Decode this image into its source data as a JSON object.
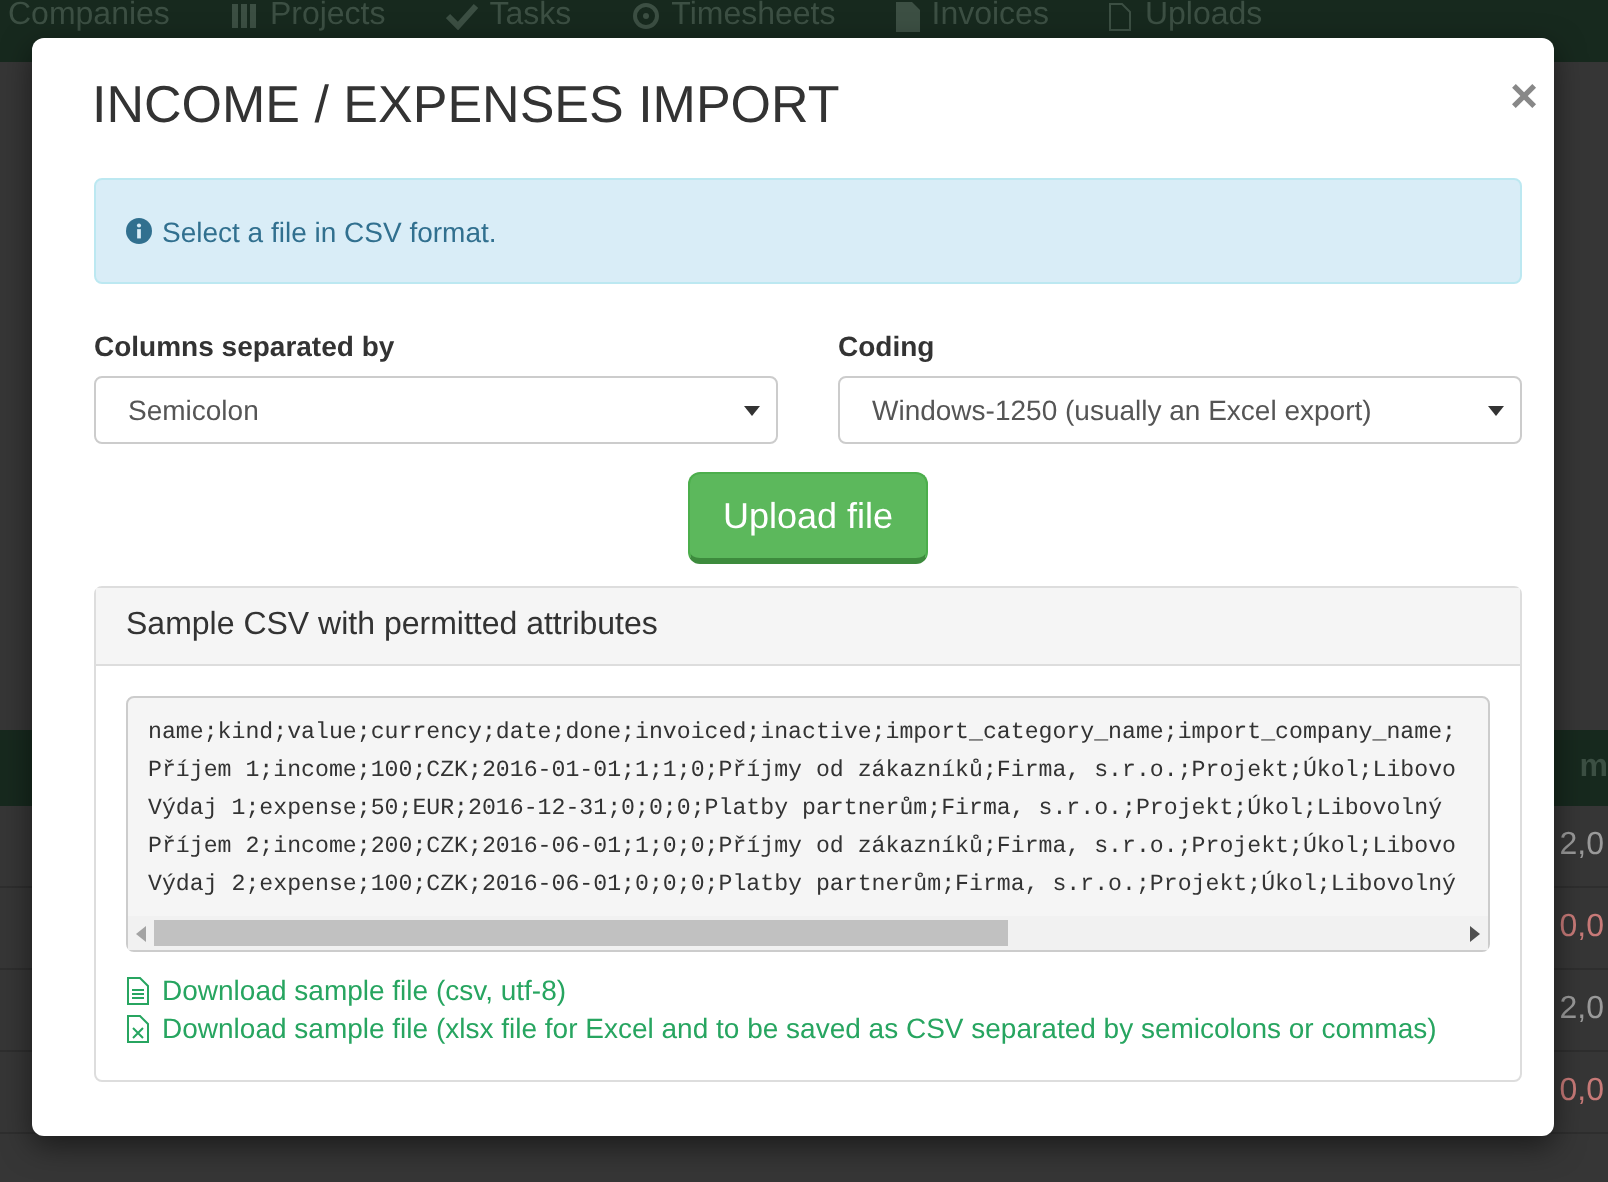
{
  "navbar": {
    "items": [
      {
        "label": "Companies",
        "kind": "none"
      },
      {
        "label": "Projects",
        "kind": "bars"
      },
      {
        "label": "Tasks",
        "kind": "check"
      },
      {
        "label": "Timesheets",
        "kind": "clock"
      },
      {
        "label": "Invoices",
        "kind": "doc"
      },
      {
        "label": "Uploads",
        "kind": "file"
      }
    ]
  },
  "background_table": {
    "header": "m",
    "cells": [
      {
        "text": "2,0",
        "color": "#9a9a9a"
      },
      {
        "text": "0,0",
        "color": "#c87a78"
      },
      {
        "text": "2,0",
        "color": "#9a9a9a"
      },
      {
        "text": "0,0",
        "color": "#c87a78"
      }
    ]
  },
  "modal": {
    "title": "INCOME / EXPENSES IMPORT",
    "close": "×",
    "alert": "Select a file in CSV format.",
    "fields": [
      {
        "label": "Columns separated by",
        "value": "Semicolon"
      },
      {
        "label": "Coding",
        "value": "Windows-1250 (usually an Excel export)"
      }
    ],
    "upload_button": "Upload file",
    "panel": {
      "heading": "Sample CSV with permitted attributes",
      "sample_lines": [
        "name;kind;value;currency;date;done;invoiced;inactive;import_category_name;import_company_name;",
        "Příjem 1;income;100;CZK;2016-01-01;1;1;0;Příjmy od zákazníků;Firma, s.r.o.;Projekt;Úkol;Libovo",
        "Výdaj 1;expense;50;EUR;2016-12-31;0;0;0;Platby partnerům;Firma, s.r.o.;Projekt;Úkol;Libovolný",
        "Příjem 2;income;200;CZK;2016-06-01;1;0;0;Příjmy od zákazníků;Firma, s.r.o.;Projekt;Úkol;Libovo",
        "Výdaj 2;expense;100;CZK;2016-06-01;0;0;0;Platby partnerům;Firma, s.r.o.;Projekt;Úkol;Libovolný"
      ],
      "links": [
        {
          "label": "Download sample file (csv, utf-8)",
          "kind": "text"
        },
        {
          "label": "Download sample file (xlsx file for Excel and to be saved as CSV separated by semicolons or commas)",
          "kind": "excel"
        }
      ]
    }
  }
}
